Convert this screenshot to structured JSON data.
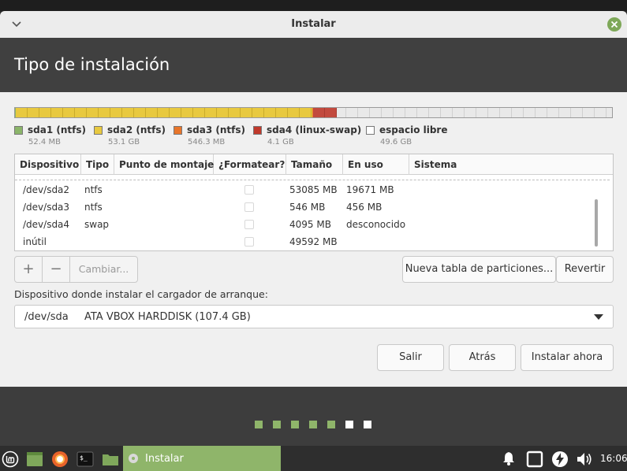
{
  "window": {
    "title": "Instalar"
  },
  "header": {
    "title": "Tipo de instalación"
  },
  "partition_bar": {
    "segments": [
      {
        "name": "sda1 (ntfs)",
        "color": "#8bb56a"
      },
      {
        "name": "sda2 (ntfs)",
        "color": "#e8c940"
      },
      {
        "name": "sda3 (ntfs)",
        "color": "#e8752a"
      },
      {
        "name": "sda4 (linux-swap)",
        "color": "#c0392b"
      },
      {
        "name": "espacio libre",
        "color": "#ffffff"
      }
    ]
  },
  "legend": [
    {
      "name": "sda1 (ntfs)",
      "size": "52.4 MB",
      "color": "#8bb56a"
    },
    {
      "name": "sda2 (ntfs)",
      "size": "53.1 GB",
      "color": "#e8c940"
    },
    {
      "name": "sda3 (ntfs)",
      "size": "546.3 MB",
      "color": "#e8752a"
    },
    {
      "name": "sda4 (linux-swap)",
      "size": "4.1 GB",
      "color": "#c0392b"
    },
    {
      "name": "espacio libre",
      "size": "49.6 GB",
      "color": "#ffffff"
    }
  ],
  "table": {
    "headers": [
      "Dispositivo",
      "Tipo",
      "Punto de montaje",
      "¿Formatear?",
      "Tamaño",
      "En uso",
      "Sistema"
    ],
    "rows": [
      {
        "device": "/dev/sda2",
        "type": "ntfs",
        "mount": "",
        "size": "53085 MB",
        "used": "19671 MB",
        "system": ""
      },
      {
        "device": "/dev/sda3",
        "type": "ntfs",
        "mount": "",
        "size": "546 MB",
        "used": "456 MB",
        "system": ""
      },
      {
        "device": "/dev/sda4",
        "type": "swap",
        "mount": "",
        "size": "4095 MB",
        "used": "desconocido",
        "system": ""
      },
      {
        "device": "inútil",
        "type": "",
        "mount": "",
        "size": "49592 MB",
        "used": "",
        "system": ""
      }
    ]
  },
  "toolbar": {
    "add": "+",
    "remove": "−",
    "change": "Cambiar...",
    "new_table": "Nueva tabla de particiones...",
    "revert": "Revertir"
  },
  "bootloader": {
    "label": "Dispositivo donde instalar el cargador de arranque:",
    "device": "/dev/sda",
    "description": "ATA VBOX HARDDISK (107.4 GB)"
  },
  "actions": {
    "quit": "Salir",
    "back": "Atrás",
    "install": "Instalar ahora"
  },
  "slideshow": {
    "dot_colors": [
      "#8fb56a",
      "#8fb56a",
      "#8fb56a",
      "#8fb56a",
      "#8fb56a",
      "#ffffff",
      "#ffffff"
    ]
  },
  "taskbar": {
    "task_label": "Instalar",
    "clock": "16:06"
  }
}
